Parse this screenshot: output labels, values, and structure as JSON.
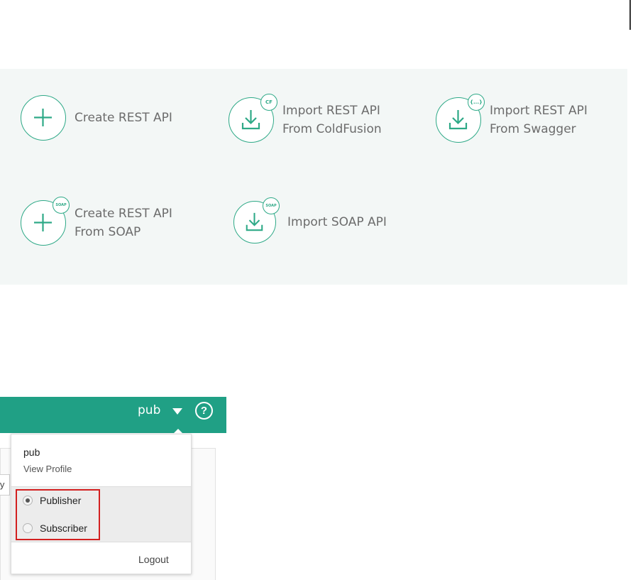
{
  "api_options": [
    {
      "label_lines": [
        "Create REST API"
      ],
      "icon": "plus-icon",
      "badge": ""
    },
    {
      "label_lines": [
        "Import REST API",
        "From ColdFusion"
      ],
      "icon": "download-icon",
      "badge": "CF"
    },
    {
      "label_lines": [
        "Import REST API",
        "From Swagger"
      ],
      "icon": "download-icon",
      "badge": "{...}"
    },
    {
      "label_lines": [
        "Create REST API",
        "From SOAP"
      ],
      "icon": "plus-icon",
      "badge": "SOAP"
    },
    {
      "label_lines": [
        "Import SOAP API"
      ],
      "icon": "download-icon",
      "badge": "SOAP"
    }
  ],
  "header": {
    "user": "pub",
    "help_symbol": "?",
    "input_fragment": "ly"
  },
  "dropdown": {
    "user": "pub",
    "view_profile": "View Profile",
    "roles": [
      {
        "label": "Publisher",
        "checked": true
      },
      {
        "label": "Subscriber",
        "checked": false
      }
    ],
    "logout": "Logout"
  },
  "colors": {
    "accent": "#2ea987",
    "header": "#20a085",
    "highlight": "#d32020"
  }
}
